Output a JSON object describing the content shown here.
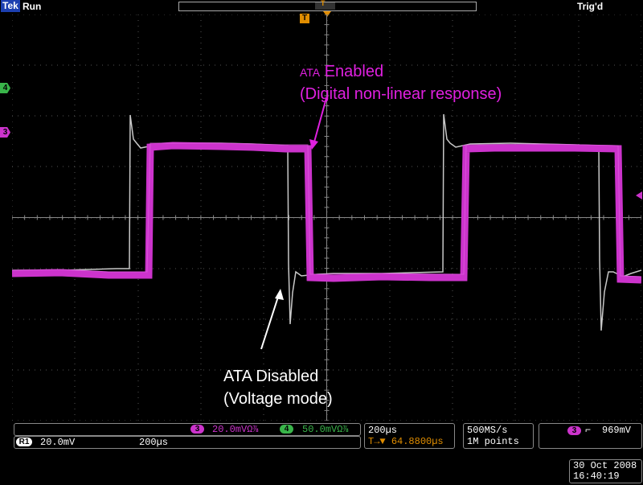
{
  "topbar": {
    "logo": "Tek",
    "run_state": "Run",
    "trigger_status": "Trig'd",
    "record_marker": "T",
    "trigger_marker": "T"
  },
  "channel_markers": {
    "ch4": "4",
    "ch3": "3"
  },
  "annotations": {
    "enabled_prefix": "ATA",
    "enabled_rest": " Enabled",
    "enabled_line2": "(Digital non-linear response)",
    "disabled_line1": "ATA Disabled",
    "disabled_line2": "(Voltage mode)"
  },
  "readouts": {
    "ch3_badge": "3",
    "ch3_scale": "20.0mVΩ⅞",
    "ch4_badge": "4",
    "ch4_scale": "50.0mVΩ⅞",
    "ref_badge": "R1",
    "ref_scale": "20.0mV",
    "ref_time": "200µs",
    "timebase": "200µs",
    "delay_icon": "T→▼",
    "delay": "64.8800µs",
    "sample_rate": "500MS/s",
    "record_length": "1M points",
    "trig_badge": "3",
    "trig_slope": "⌐",
    "trig_level": "969mV",
    "date": "30 Oct  2008",
    "time": "16:40:19"
  },
  "colors": {
    "ch3": "#cc33cc",
    "ch4": "#39b54a",
    "reference": "#c8c8c8",
    "trigger": "#e08d00"
  }
}
